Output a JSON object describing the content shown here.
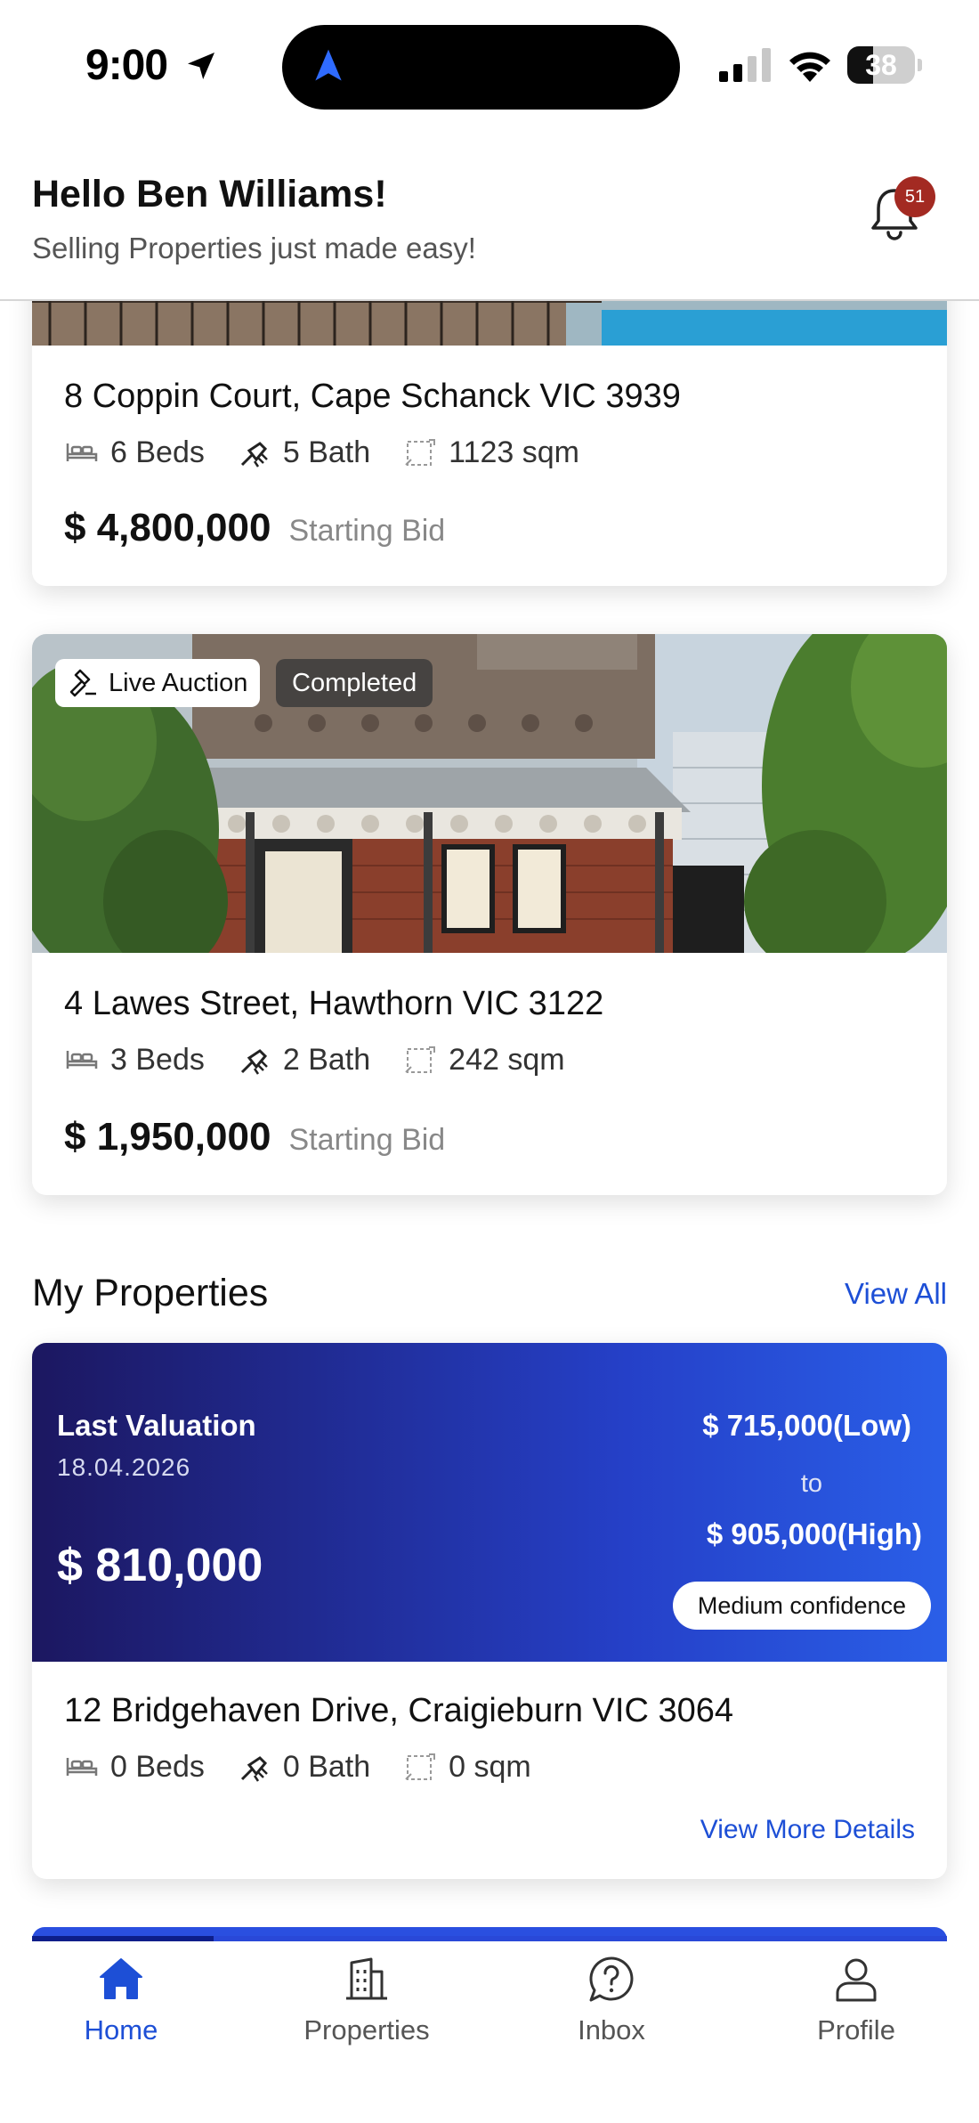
{
  "status_bar": {
    "time": "9:00",
    "battery_level": "38"
  },
  "header": {
    "greeting": "Hello Ben Williams!",
    "tagline": "Selling Properties just made easy!",
    "notification_count": "51"
  },
  "auction_listings": [
    {
      "address": "8 Coppin Court, Cape Schanck VIC 3939",
      "beds": "6 Beds",
      "baths": "5 Bath",
      "area": "1123 sqm",
      "price": "$ 4,800,000",
      "price_note": "Starting Bid"
    },
    {
      "live_tag": "Live Auction",
      "status_tag": "Completed",
      "address": "4 Lawes Street, Hawthorn VIC 3122",
      "beds": "3 Beds",
      "baths": "2 Bath",
      "area": "242 sqm",
      "price": "$ 1,950,000",
      "price_note": "Starting Bid"
    }
  ],
  "my_properties": {
    "title": "My Properties",
    "view_all": "View All",
    "items": [
      {
        "valuation_label": "Last Valuation",
        "valuation_date": "18.04.2026",
        "valuation_amount": "$ 810,000",
        "low": "$ 715,000(Low)",
        "to": "to",
        "high": "$ 905,000(High)",
        "confidence": "Medium confidence",
        "address": "12 Bridgehaven Drive, Craigieburn VIC 3064",
        "beds": "0 Beds",
        "baths": "0 Bath",
        "area": "0 sqm",
        "details_link": "View More Details"
      }
    ]
  },
  "tabs": [
    {
      "label": "Home",
      "icon": "home-icon",
      "active": true
    },
    {
      "label": "Properties",
      "icon": "building-icon",
      "active": false
    },
    {
      "label": "Inbox",
      "icon": "question-chat-icon",
      "active": false
    },
    {
      "label": "Profile",
      "icon": "user-icon",
      "active": false
    }
  ],
  "colors": {
    "accent": "#1d4fd6",
    "badge": "#a32a22",
    "valuation_gradient_start": "#1c1760",
    "valuation_gradient_end": "#2a5fe8"
  }
}
